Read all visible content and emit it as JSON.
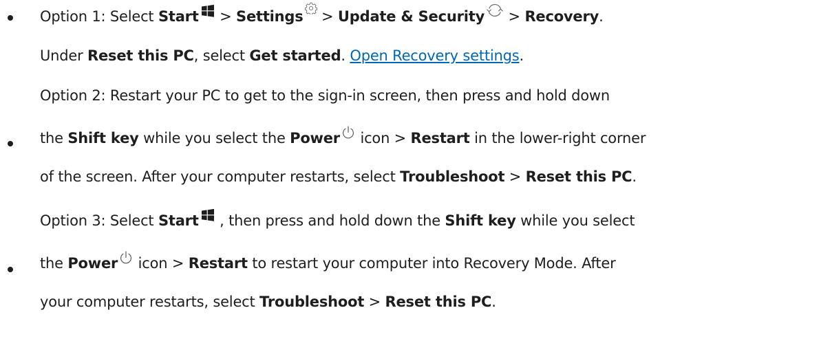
{
  "options": [
    {
      "lines": [
        {
          "segments": [
            {
              "type": "text",
              "text": "Option 1: Select "
            },
            {
              "type": "bold",
              "text": "Start"
            },
            {
              "type": "icon",
              "icon": "windows-start-icon"
            },
            {
              "type": "text",
              "text": " > "
            },
            {
              "type": "bold",
              "text": "Settings"
            },
            {
              "type": "icon",
              "icon": "gear-icon"
            },
            {
              "type": "text",
              "text": " > "
            },
            {
              "type": "bold",
              "text": "Update & Security"
            },
            {
              "type": "icon",
              "icon": "refresh-icon"
            },
            {
              "type": "text",
              "text": " > "
            },
            {
              "type": "bold",
              "text": "Recovery"
            },
            {
              "type": "text",
              "text": "."
            }
          ]
        },
        {
          "segments": [
            {
              "type": "text",
              "text": "Under "
            },
            {
              "type": "bold",
              "text": "Reset this PC"
            },
            {
              "type": "text",
              "text": ", select "
            },
            {
              "type": "bold",
              "text": "Get started"
            },
            {
              "type": "text",
              "text": ". "
            },
            {
              "type": "link",
              "text": "Open Recovery settings"
            },
            {
              "type": "text",
              "text": "."
            }
          ]
        }
      ]
    },
    {
      "lines": [
        {
          "segments": [
            {
              "type": "text",
              "text": "Option 2: Restart your PC to get to the sign-in screen, then press and hold down"
            }
          ]
        },
        {
          "segments": [
            {
              "type": "text",
              "text": "the "
            },
            {
              "type": "bold",
              "text": "Shift key"
            },
            {
              "type": "text",
              "text": " while you select the "
            },
            {
              "type": "bold",
              "text": "Power"
            },
            {
              "type": "icon",
              "icon": "power-icon"
            },
            {
              "type": "text",
              "text": " icon > "
            },
            {
              "type": "bold",
              "text": "Restart"
            },
            {
              "type": "text",
              "text": " in the lower-right corner"
            }
          ]
        },
        {
          "segments": [
            {
              "type": "text",
              "text": "of the screen. After your computer restarts, select "
            },
            {
              "type": "bold",
              "text": "Troubleshoot"
            },
            {
              "type": "text",
              "text": " > "
            },
            {
              "type": "bold",
              "text": "Reset this PC"
            },
            {
              "type": "text",
              "text": "."
            }
          ]
        }
      ]
    },
    {
      "lines": [
        {
          "segments": [
            {
              "type": "text",
              "text": "Option 3: Select "
            },
            {
              "type": "bold",
              "text": "Start"
            },
            {
              "type": "icon",
              "icon": "windows-start-icon"
            },
            {
              "type": "text",
              "text": " , then press and hold down the "
            },
            {
              "type": "bold",
              "text": "Shift key"
            },
            {
              "type": "text",
              "text": " while you select"
            }
          ]
        },
        {
          "segments": [
            {
              "type": "text",
              "text": "the "
            },
            {
              "type": "bold",
              "text": "Power"
            },
            {
              "type": "icon",
              "icon": "power-icon"
            },
            {
              "type": "text",
              "text": " icon > "
            },
            {
              "type": "bold",
              "text": "Restart"
            },
            {
              "type": "text",
              "text": " to restart your computer into Recovery Mode. After"
            }
          ]
        },
        {
          "segments": [
            {
              "type": "text",
              "text": "your computer restarts, select "
            },
            {
              "type": "bold",
              "text": "Troubleshoot"
            },
            {
              "type": "text",
              "text": " > "
            },
            {
              "type": "bold",
              "text": "Reset this PC"
            },
            {
              "type": "text",
              "text": "."
            }
          ]
        }
      ]
    }
  ],
  "colors": {
    "text": "#1e1e1e",
    "link": "#0067b8",
    "windows_logo": "#1e1e1e",
    "line_icons": "#5a5a5a"
  }
}
